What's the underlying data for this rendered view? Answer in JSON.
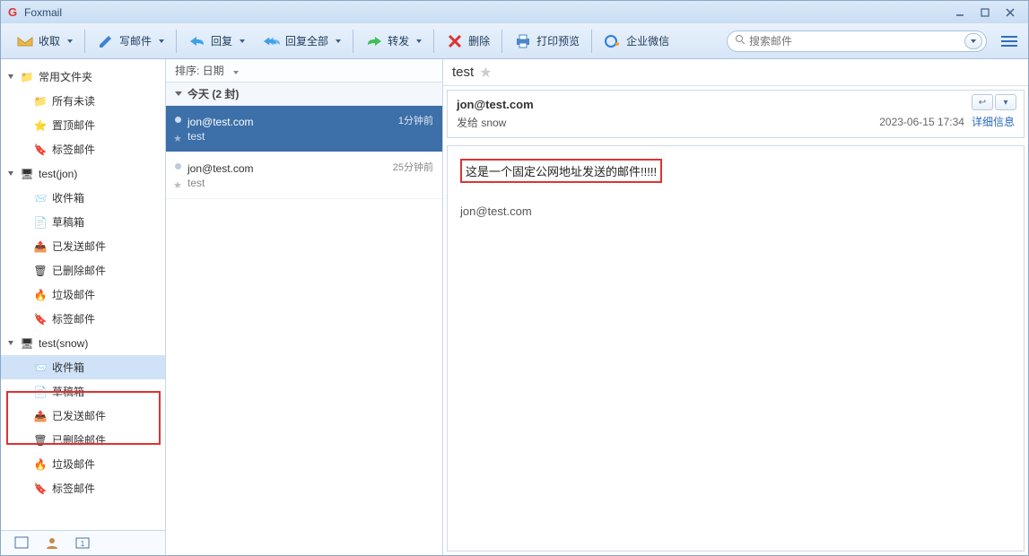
{
  "titlebar": {
    "app_name": "Foxmail"
  },
  "toolbar": {
    "receive": "收取",
    "compose": "写邮件",
    "reply": "回复",
    "reply_all": "回复全部",
    "forward": "转发",
    "delete": "删除",
    "print": "打印预览",
    "enterprise": "企业微信"
  },
  "search": {
    "placeholder": "搜索邮件"
  },
  "sidebar": {
    "common": {
      "label": "常用文件夹",
      "all_unread": "所有未读",
      "pinned": "置顶邮件",
      "tagged": "标签邮件"
    },
    "acct1": {
      "label": "test(jon)",
      "inbox": "收件箱",
      "drafts": "草稿箱",
      "sent": "已发送邮件",
      "trash": "已删除邮件",
      "junk": "垃圾邮件",
      "tags": "标签邮件"
    },
    "acct2": {
      "label": "test(snow)",
      "inbox": "收件箱",
      "drafts": "草稿箱",
      "sent": "已发送邮件",
      "trash": "已删除邮件",
      "junk": "垃圾邮件",
      "tags": "标签邮件"
    }
  },
  "list": {
    "sort_label": "排序: 日期",
    "group": "今天 (2 封)",
    "msgs": [
      {
        "from": "jon@test.com",
        "subject": "test",
        "time": "1分钟前"
      },
      {
        "from": "jon@test.com",
        "subject": "test",
        "time": "25分钟前"
      }
    ]
  },
  "preview": {
    "title": "test",
    "from": "jon@test.com",
    "to_label": "发给 snow",
    "date": "2023-06-15 17:34",
    "details_link": "详细信息",
    "body_line": "这是一个固定公网地址发送的邮件!!!!!",
    "signature": "jon@test.com"
  }
}
